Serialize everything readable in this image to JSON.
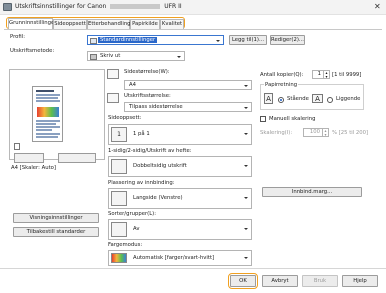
{
  "window": {
    "title_prefix": "Utskriftsinnstillinger for Canon",
    "title_suffix": "UFR II",
    "close": "✕"
  },
  "tabs": [
    {
      "label": "Grunninnstillinger",
      "active": true
    },
    {
      "label": "Sideoppsett",
      "active": false
    },
    {
      "label": "Etterbehandling",
      "active": false
    },
    {
      "label": "Papirkilde",
      "active": false
    },
    {
      "label": "Kvalitet",
      "active": false
    }
  ],
  "profile": {
    "label": "Profil:",
    "value": "Standardinnstillinger",
    "add_button": "Legg til(1)...",
    "edit_button": "Rediger(2)..."
  },
  "output": {
    "label": "Utskriftsmetode:",
    "value": "Skriv ut"
  },
  "preview": {
    "caption": "A4 [Skaler: Auto]"
  },
  "left_buttons": {
    "print_settings": "Visningsinnstillinger",
    "restore_defaults": "Tilbakestill standarder"
  },
  "page_size": {
    "label": "Sidestørrelse(W):",
    "value": "A4"
  },
  "output_size": {
    "label": "Utskriftsstørrelse:",
    "value": "Tilpass sidestørrelse"
  },
  "page_layout": {
    "label": "Sideoppsett:",
    "value": "1 på 1",
    "icon_text": "1"
  },
  "duplex": {
    "label": "1-sidig/2-sidig/Utskrift av hefte:",
    "value": "Dobbeltsidig utskrift"
  },
  "binding": {
    "label": "Plassering av innbinding:",
    "value": "Langside (Venstre)",
    "margin_button": "Innbind.marg..."
  },
  "sort": {
    "label": "Sorter/grupper(L):",
    "value": "Av"
  },
  "color": {
    "label": "Fargemodus:",
    "value": "Automatisk [farger/svart-hvitt]"
  },
  "copies": {
    "label": "Antall kopier(Q):",
    "value": "1",
    "range": "[1 til 9999]"
  },
  "orientation": {
    "label": "Papirretning",
    "portrait": "Stående",
    "landscape": "Liggende",
    "selected": "portrait"
  },
  "manual_scaling": {
    "label": "Manuell skalering"
  },
  "scaling": {
    "label": "Skalering(I):",
    "value": "100",
    "range": "% [25 til 200]"
  },
  "footer": {
    "ok": "OK",
    "cancel": "Avbryt",
    "apply": "Bruk",
    "help": "Hjelp"
  }
}
